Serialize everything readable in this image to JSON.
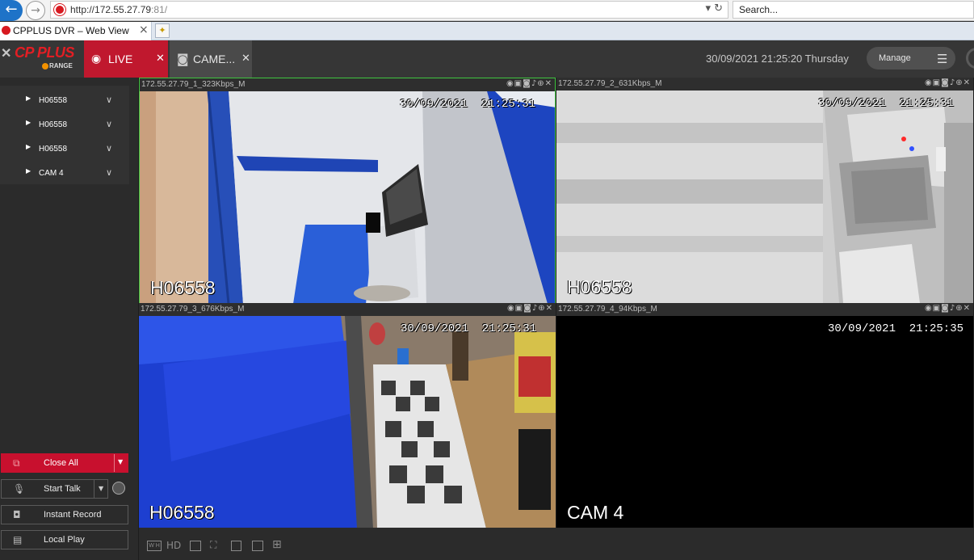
{
  "browser": {
    "url_host": "http://172.55.27.79",
    "url_port": ":81/",
    "search_placeholder": "Search...",
    "tab_title": "CPPLUS DVR – Web View",
    "back_icon": "back-arrow-icon",
    "forward_icon": "forward-arrow-icon"
  },
  "header": {
    "logo_text": "CP PLUS",
    "logo_sub": "RANGE",
    "tabs": [
      {
        "label": "LIVE",
        "icon": "eye-icon",
        "active": true
      },
      {
        "label": "CAME...",
        "icon": "camera-icon",
        "active": false
      }
    ],
    "datetime": "30/09/2021 21:25:20 Thursday",
    "manage_label": "Manage",
    "accent_color": "#c0182e"
  },
  "sidebar": {
    "devices": [
      {
        "label": "H06558"
      },
      {
        "label": "H06558"
      },
      {
        "label": "H06558"
      },
      {
        "label": "CAM 4"
      }
    ],
    "buttons": {
      "close_all": "Close All",
      "start_talk": "Start Talk",
      "instant_record": "Instant Record",
      "local_play": "Local Play"
    }
  },
  "panes": [
    {
      "title": "172.55.27.79_1_323Kbps_M",
      "stamp": "30/09/2021  21:25:31",
      "name": "H06558",
      "selected": true
    },
    {
      "title": "172.55.27.79_2_631Kbps_M",
      "stamp": "30/09/2021  21:25:31",
      "name": "H06558",
      "selected": false
    },
    {
      "title": "172.55.27.79_3_676Kbps_M",
      "stamp": "30/09/2021  21:25:31",
      "name": "H06558",
      "selected": false
    },
    {
      "title": "172.55.27.79_4_94Kbps_M",
      "stamp": "30/09/2021  21:25:35",
      "name": "CAM 4",
      "selected": false
    }
  ],
  "bottombar": {
    "wh_label": "W H",
    "hd_label": "HD"
  }
}
